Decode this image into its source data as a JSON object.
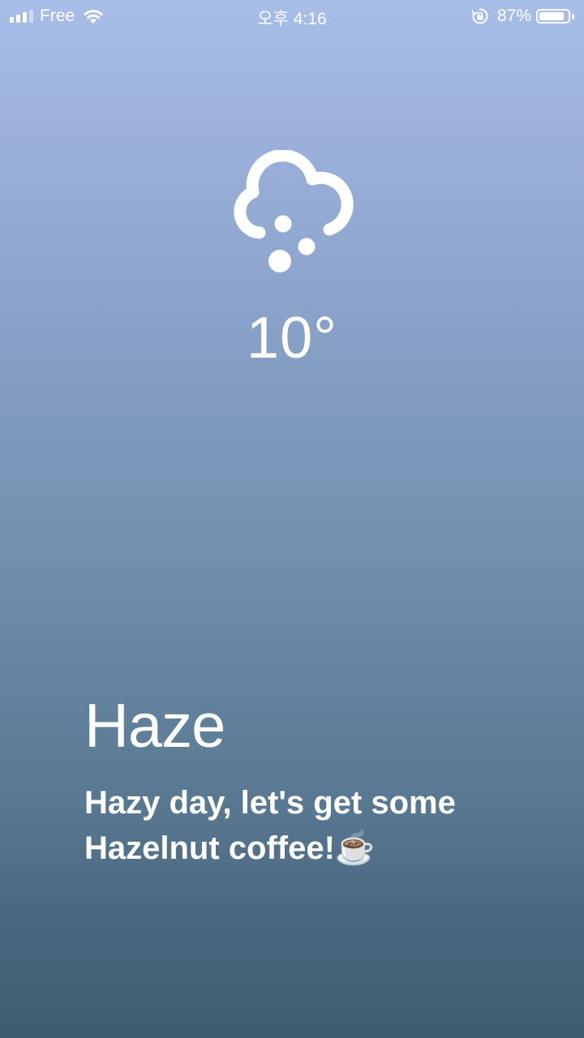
{
  "status_bar": {
    "carrier": "Free",
    "time": "오후 4:16",
    "battery_percent": "87%",
    "battery_level": 0.87,
    "icons": [
      "signal-icon",
      "wifi-icon",
      "rotation-lock-icon",
      "battery-icon"
    ]
  },
  "weather": {
    "icon": "haze-cloud-icon",
    "temperature": "10°",
    "condition": "Haze",
    "message": "Hazy day, let's get some Hazelnut coffee!☕️"
  },
  "colors": {
    "background_top": "#a7bee8",
    "background_bottom": "#3e5c71",
    "text": "#ffffff"
  }
}
